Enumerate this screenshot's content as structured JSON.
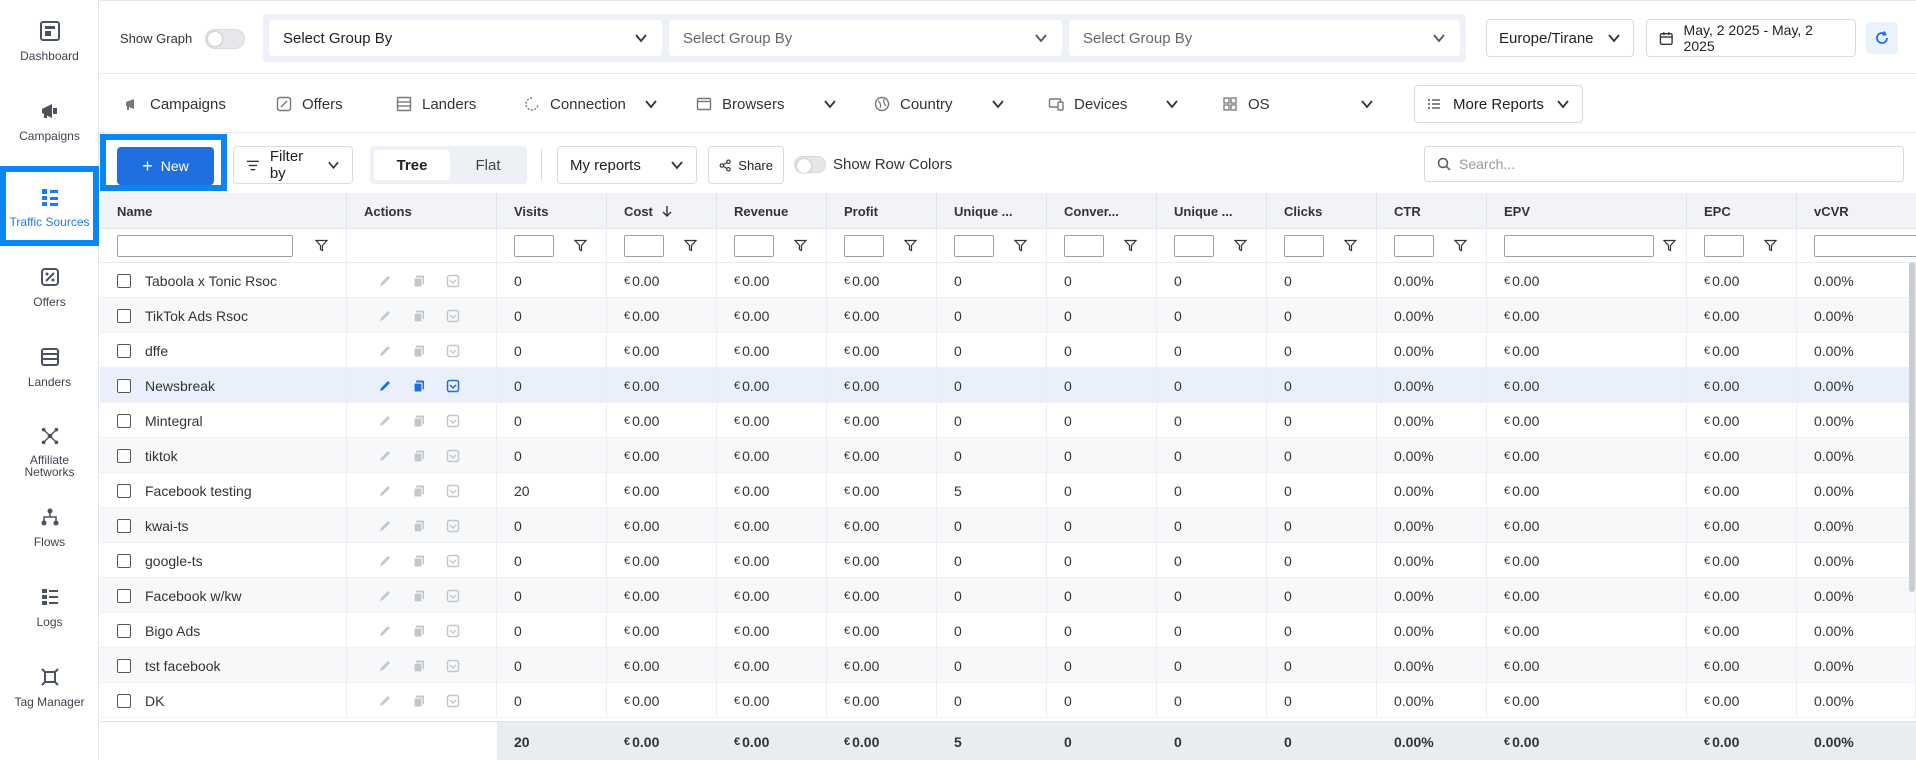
{
  "sidebar": {
    "items": [
      {
        "label": "Dashboard",
        "icon": "dashboard-icon"
      },
      {
        "label": "Campaigns",
        "icon": "megaphone-icon"
      },
      {
        "label": "Traffic Sources",
        "icon": "traffic-sources-icon",
        "active": true
      },
      {
        "label": "Offers",
        "icon": "offers-icon"
      },
      {
        "label": "Landers",
        "icon": "landers-icon"
      },
      {
        "label": "Affiliate Networks",
        "icon": "network-icon"
      },
      {
        "label": "Flows",
        "icon": "flows-icon"
      },
      {
        "label": "Logs",
        "icon": "logs-icon"
      },
      {
        "label": "Tag Manager",
        "icon": "tag-manager-icon"
      }
    ]
  },
  "topbar": {
    "show_graph_label": "Show Graph",
    "group_by": [
      "Select Group By",
      "Select Group By",
      "Select Group By"
    ],
    "timezone": "Europe/Tirane",
    "date_range": "May, 2 2025 - May, 2 2025"
  },
  "report_tabs": [
    {
      "label": "Campaigns",
      "icon": "megaphone-icon",
      "dropdown": false
    },
    {
      "label": "Offers",
      "icon": "offers-icon",
      "dropdown": false
    },
    {
      "label": "Landers",
      "icon": "landers-icon",
      "dropdown": false
    },
    {
      "label": "Connection",
      "icon": "connection-icon",
      "dropdown": true
    },
    {
      "label": "Browsers",
      "icon": "browser-icon",
      "dropdown": true
    },
    {
      "label": "Country",
      "icon": "globe-icon",
      "dropdown": true
    },
    {
      "label": "Devices",
      "icon": "devices-icon",
      "dropdown": true
    },
    {
      "label": "OS",
      "icon": "os-icon",
      "dropdown": true
    },
    {
      "label": "More Reports",
      "icon": "list-icon",
      "dropdown": true
    }
  ],
  "toolbar": {
    "new_label": "New",
    "filter_label": "Filter by",
    "view_tree": "Tree",
    "view_flat": "Flat",
    "my_reports": "My reports",
    "share": "Share",
    "row_colors_label": "Show Row Colors",
    "search_placeholder": "Search..."
  },
  "table": {
    "columns": [
      "Name",
      "Actions",
      "Visits",
      "Cost",
      "Revenue",
      "Profit",
      "Unique ...",
      "Conver...",
      "Unique ...",
      "Clicks",
      "CTR",
      "EPV",
      "EPC",
      "vCVR"
    ],
    "currency": "€",
    "rows": [
      {
        "name": "Taboola x Tonic Rsoc",
        "visits": "0",
        "cost": "0.00",
        "revenue": "0.00",
        "profit": "0.00",
        "unique1": "0",
        "conv": "0",
        "unique2": "0",
        "clicks": "0",
        "ctr": "0.00%",
        "epv": "0.00",
        "epc": "0.00",
        "vcvr": "0.00%"
      },
      {
        "name": "TikTok Ads Rsoc",
        "visits": "0",
        "cost": "0.00",
        "revenue": "0.00",
        "profit": "0.00",
        "unique1": "0",
        "conv": "0",
        "unique2": "0",
        "clicks": "0",
        "ctr": "0.00%",
        "epv": "0.00",
        "epc": "0.00",
        "vcvr": "0.00%"
      },
      {
        "name": "dffe",
        "visits": "0",
        "cost": "0.00",
        "revenue": "0.00",
        "profit": "0.00",
        "unique1": "0",
        "conv": "0",
        "unique2": "0",
        "clicks": "0",
        "ctr": "0.00%",
        "epv": "0.00",
        "epc": "0.00",
        "vcvr": "0.00%"
      },
      {
        "name": "Newsbreak",
        "visits": "0",
        "cost": "0.00",
        "revenue": "0.00",
        "profit": "0.00",
        "unique1": "0",
        "conv": "0",
        "unique2": "0",
        "clicks": "0",
        "ctr": "0.00%",
        "epv": "0.00",
        "epc": "0.00",
        "vcvr": "0.00%",
        "highlight": true
      },
      {
        "name": "Mintegral",
        "visits": "0",
        "cost": "0.00",
        "revenue": "0.00",
        "profit": "0.00",
        "unique1": "0",
        "conv": "0",
        "unique2": "0",
        "clicks": "0",
        "ctr": "0.00%",
        "epv": "0.00",
        "epc": "0.00",
        "vcvr": "0.00%"
      },
      {
        "name": "tiktok",
        "visits": "0",
        "cost": "0.00",
        "revenue": "0.00",
        "profit": "0.00",
        "unique1": "0",
        "conv": "0",
        "unique2": "0",
        "clicks": "0",
        "ctr": "0.00%",
        "epv": "0.00",
        "epc": "0.00",
        "vcvr": "0.00%"
      },
      {
        "name": "Facebook testing",
        "visits": "20",
        "cost": "0.00",
        "revenue": "0.00",
        "profit": "0.00",
        "unique1": "5",
        "conv": "0",
        "unique2": "0",
        "clicks": "0",
        "ctr": "0.00%",
        "epv": "0.00",
        "epc": "0.00",
        "vcvr": "0.00%"
      },
      {
        "name": "kwai-ts",
        "visits": "0",
        "cost": "0.00",
        "revenue": "0.00",
        "profit": "0.00",
        "unique1": "0",
        "conv": "0",
        "unique2": "0",
        "clicks": "0",
        "ctr": "0.00%",
        "epv": "0.00",
        "epc": "0.00",
        "vcvr": "0.00%"
      },
      {
        "name": "google-ts",
        "visits": "0",
        "cost": "0.00",
        "revenue": "0.00",
        "profit": "0.00",
        "unique1": "0",
        "conv": "0",
        "unique2": "0",
        "clicks": "0",
        "ctr": "0.00%",
        "epv": "0.00",
        "epc": "0.00",
        "vcvr": "0.00%"
      },
      {
        "name": "Facebook w/kw",
        "visits": "0",
        "cost": "0.00",
        "revenue": "0.00",
        "profit": "0.00",
        "unique1": "0",
        "conv": "0",
        "unique2": "0",
        "clicks": "0",
        "ctr": "0.00%",
        "epv": "0.00",
        "epc": "0.00",
        "vcvr": "0.00%"
      },
      {
        "name": "Bigo Ads",
        "visits": "0",
        "cost": "0.00",
        "revenue": "0.00",
        "profit": "0.00",
        "unique1": "0",
        "conv": "0",
        "unique2": "0",
        "clicks": "0",
        "ctr": "0.00%",
        "epv": "0.00",
        "epc": "0.00",
        "vcvr": "0.00%"
      },
      {
        "name": "tst facebook",
        "visits": "0",
        "cost": "0.00",
        "revenue": "0.00",
        "profit": "0.00",
        "unique1": "0",
        "conv": "0",
        "unique2": "0",
        "clicks": "0",
        "ctr": "0.00%",
        "epv": "0.00",
        "epc": "0.00",
        "vcvr": "0.00%"
      },
      {
        "name": "DK",
        "visits": "0",
        "cost": "0.00",
        "revenue": "0.00",
        "profit": "0.00",
        "unique1": "0",
        "conv": "0",
        "unique2": "0",
        "clicks": "0",
        "ctr": "0.00%",
        "epv": "0.00",
        "epc": "0.00",
        "vcvr": "0.00%"
      }
    ],
    "totals": {
      "visits": "20",
      "cost": "0.00",
      "revenue": "0.00",
      "profit": "0.00",
      "unique1": "5",
      "conv": "0",
      "unique2": "0",
      "clicks": "0",
      "ctr": "0.00%",
      "epv": "0.00",
      "epc": "0.00",
      "vcvr": "0.00%"
    }
  },
  "colors": {
    "accent": "#1f6fe0",
    "highlight_border": "#0a86f2",
    "row_highlight": "#e9f0fb"
  }
}
